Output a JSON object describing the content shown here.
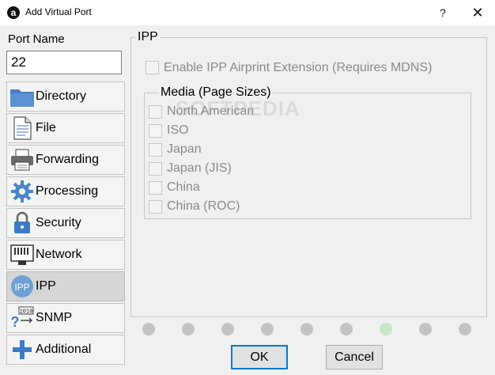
{
  "window": {
    "logo": "a",
    "title": "Add Virtual Port",
    "help_label": "?",
    "close_label": "✕"
  },
  "port_name": {
    "label": "Port Name",
    "value": "22"
  },
  "nav": {
    "items": [
      {
        "label": "Directory",
        "icon": "folder-icon"
      },
      {
        "label": "File",
        "icon": "file-icon"
      },
      {
        "label": "Forwarding",
        "icon": "printer-icon"
      },
      {
        "label": "Processing",
        "icon": "gear-icon"
      },
      {
        "label": "Security",
        "icon": "padlock-icon"
      },
      {
        "label": "Network",
        "icon": "network-port-icon"
      },
      {
        "label": "IPP",
        "icon": "ipp-icon",
        "selected": true
      },
      {
        "label": "SNMP",
        "icon": "snmp-icon"
      },
      {
        "label": "Additional",
        "icon": "plus-icon"
      }
    ],
    "ipp_icon_text": "IPP",
    "snmp_icon_text": "1010"
  },
  "ipp": {
    "group_title": "IPP",
    "airprint_label": "Enable IPP Airprint Extension (Requires MDNS)",
    "airprint_checked": false,
    "media": {
      "title": "Media (Page Sizes)",
      "options": [
        {
          "label": "North American",
          "checked": false
        },
        {
          "label": "ISO",
          "checked": false
        },
        {
          "label": "Japan",
          "checked": false
        },
        {
          "label": "Japan (JIS)",
          "checked": false
        },
        {
          "label": "China",
          "checked": false
        },
        {
          "label": "China (ROC)",
          "checked": false
        }
      ]
    }
  },
  "watermark": "SOFTPEDIA",
  "progress": {
    "total_steps": 9,
    "current_step": 7,
    "inactive_color": "#c3c3c3",
    "active_color": "#c6e8c6"
  },
  "buttons": {
    "ok_label": "OK",
    "cancel_label": "Cancel"
  },
  "colors": {
    "accent": "#0078d7",
    "folder": "#4a7fc1"
  }
}
